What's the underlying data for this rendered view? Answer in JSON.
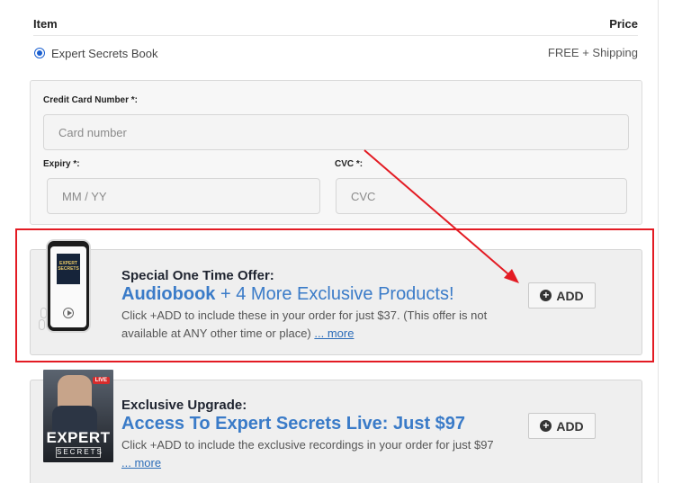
{
  "header": {
    "item_label": "Item",
    "price_label": "Price"
  },
  "product": {
    "name": "Expert Secrets Book",
    "price": "FREE + Shipping",
    "selected": true
  },
  "payment": {
    "card_label": "Credit Card Number *:",
    "card_placeholder": "Card number",
    "expiry_label": "Expiry *:",
    "expiry_placeholder": "MM / YY",
    "cvc_label": "CVC *:",
    "cvc_placeholder": "CVC"
  },
  "offers": [
    {
      "title": "Special One Time Offer:",
      "headline_bold": "Audiobook",
      "headline_rest": " + 4 More Exclusive Products!",
      "description": "Click +ADD to include these in your order for just $37. (This offer is not available at ANY other time or place)",
      "more_link": "... more",
      "button_label": "ADD",
      "image_icon": "phone-audiobook-icon",
      "cover_text": "EXPERT SECRETS"
    },
    {
      "title": "Exclusive Upgrade:",
      "headline_bold": "Access To Expert Secrets Live: Just $97",
      "headline_rest": "",
      "description": "Click +ADD to include the exclusive recordings in your order for just $97",
      "more_link": "... more",
      "button_label": "ADD",
      "image_icon": "book-cover-icon",
      "cover_badge": "LIVE",
      "cover_title": "EXPERT",
      "cover_subtitle": "SECRETS"
    }
  ],
  "annotation": {
    "highlight_color": "#e31b23"
  },
  "colors": {
    "accent": "#3a7bc8",
    "radio": "#1a5fd0"
  }
}
